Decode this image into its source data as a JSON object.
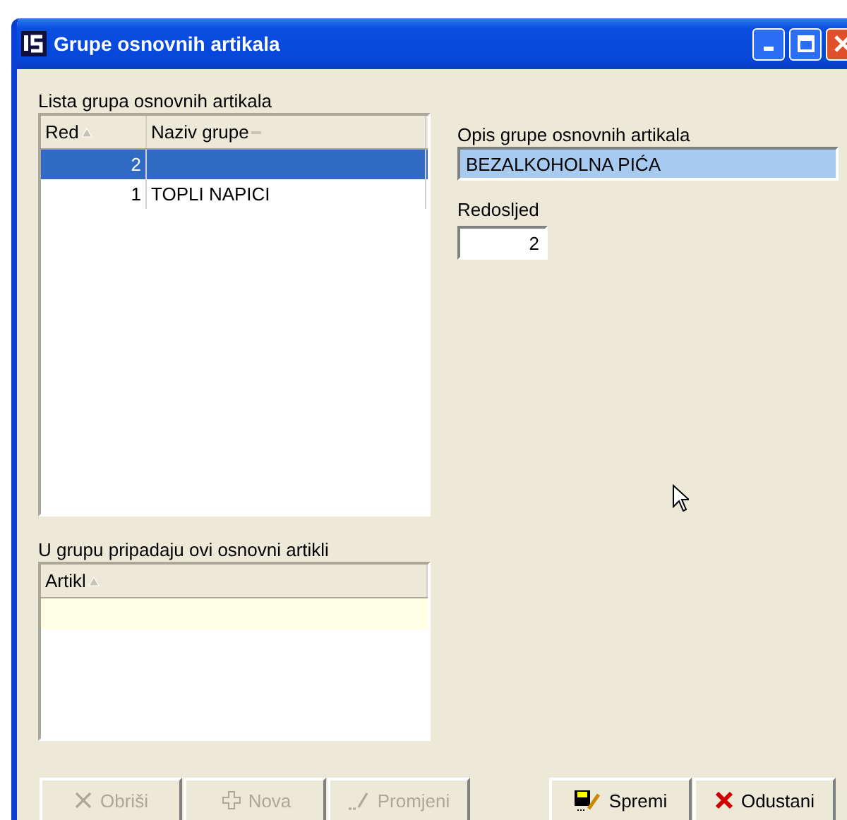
{
  "window": {
    "title": "Grupe osnovnih artikala"
  },
  "group_list": {
    "label": "Lista grupa osnovnih artikala",
    "columns": [
      {
        "label": "Red",
        "sorted": true
      },
      {
        "label": "Naziv grupe",
        "sorted": false
      }
    ],
    "rows": [
      {
        "cells": [
          "2",
          ""
        ],
        "selected": true
      },
      {
        "cells": [
          "1",
          "TOPLI NAPICI"
        ],
        "selected": false
      }
    ]
  },
  "description": {
    "label": "Opis grupe osnovnih artikala",
    "value": "BEZALKOHOLNA PIĆA"
  },
  "order": {
    "label": "Redosljed",
    "value": "2"
  },
  "article_list": {
    "label": "U grupu pripadaju ovi osnovni artikli",
    "columns": [
      {
        "label": "Artikl",
        "sorted": true
      }
    ]
  },
  "buttons": [
    {
      "label": "Obriši",
      "kind": "delete",
      "disabled": true
    },
    {
      "label": "Nova",
      "kind": "new",
      "disabled": true
    },
    {
      "label": "Promjeni",
      "kind": "edit",
      "disabled": true
    },
    {
      "label": "Spremi",
      "kind": "save",
      "disabled": false
    },
    {
      "label": "Odustani",
      "kind": "cancel",
      "disabled": false
    }
  ]
}
